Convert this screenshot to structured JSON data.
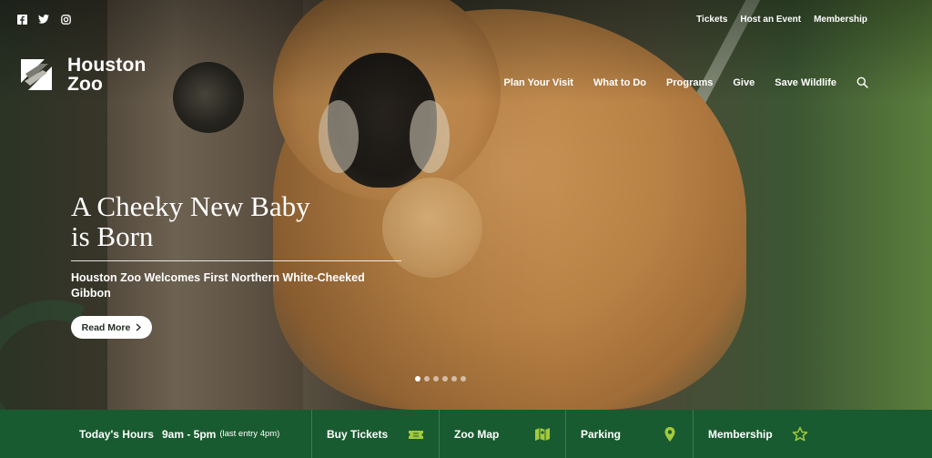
{
  "social": {
    "items": [
      {
        "name": "facebook-icon"
      },
      {
        "name": "twitter-icon"
      },
      {
        "name": "instagram-icon"
      }
    ]
  },
  "utility_nav": {
    "tickets": "Tickets",
    "host_event": "Host an Event",
    "membership": "Membership"
  },
  "logo": {
    "line1": "Houston",
    "line2": "Zoo"
  },
  "main_nav": {
    "plan_visit": "Plan Your Visit",
    "what_to_do": "What to Do",
    "programs": "Programs",
    "give": "Give",
    "save_wildlife": "Save Wildlife"
  },
  "hero": {
    "headline_line1": "A Cheeky New Baby",
    "headline_line2": "is Born",
    "subhead": "Houston Zoo Welcomes First Northern White-Cheeked Gibbon",
    "cta": "Read More",
    "slide_count": 6,
    "active_slide": 1
  },
  "bottom_bar": {
    "hours_label": "Today's Hours",
    "hours_time": "9am - 5pm",
    "hours_note": "(last entry 4pm)",
    "buy_tickets": "Buy Tickets",
    "zoo_map": "Zoo Map",
    "parking": "Parking",
    "membership": "Membership"
  },
  "colors": {
    "bottom_bar_bg": "#195b30",
    "icon_accent": "#a4c93a",
    "text": "#ffffff"
  }
}
